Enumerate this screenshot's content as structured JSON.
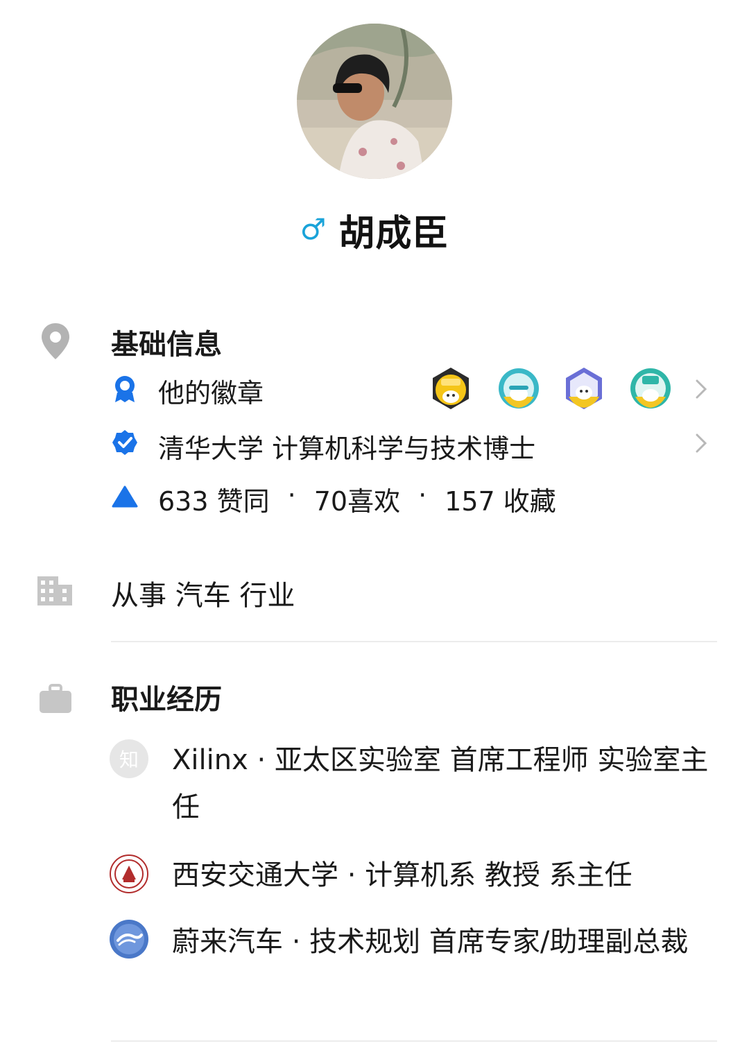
{
  "profile": {
    "name": "胡成臣",
    "gender_symbol": "♂"
  },
  "basic": {
    "title": "基础信息",
    "badges_label": "他的徽章",
    "badge_icons": [
      "365-day-badge-icon",
      "badge-teal-icon",
      "badge-purple-icon",
      "thanks-badge-icon"
    ],
    "education": "清华大学 计算机科学与技术博士",
    "stats": {
      "agree": "633 赞同",
      "sep1": "·",
      "likes": "70喜欢",
      "sep2": "·",
      "collect": "157 收藏"
    }
  },
  "industry": {
    "text": "从事 汽车 行业"
  },
  "career": {
    "title": "职业经历",
    "items": [
      {
        "logo_text": "知",
        "text": "Xilinx · 亚太区实验室 首席工程师 实验室主任"
      },
      {
        "logo_text": "",
        "text": "西安交通大学 · 计算机系 教授 系主任"
      },
      {
        "logo_text": "",
        "text": "蔚来汽车 · 技术规划 首席专家/助理副总裁"
      }
    ]
  },
  "colors": {
    "accent_blue": "#1a73e8",
    "gender_blue": "#1aa3d9",
    "icon_gray": "#b3b3b3"
  }
}
